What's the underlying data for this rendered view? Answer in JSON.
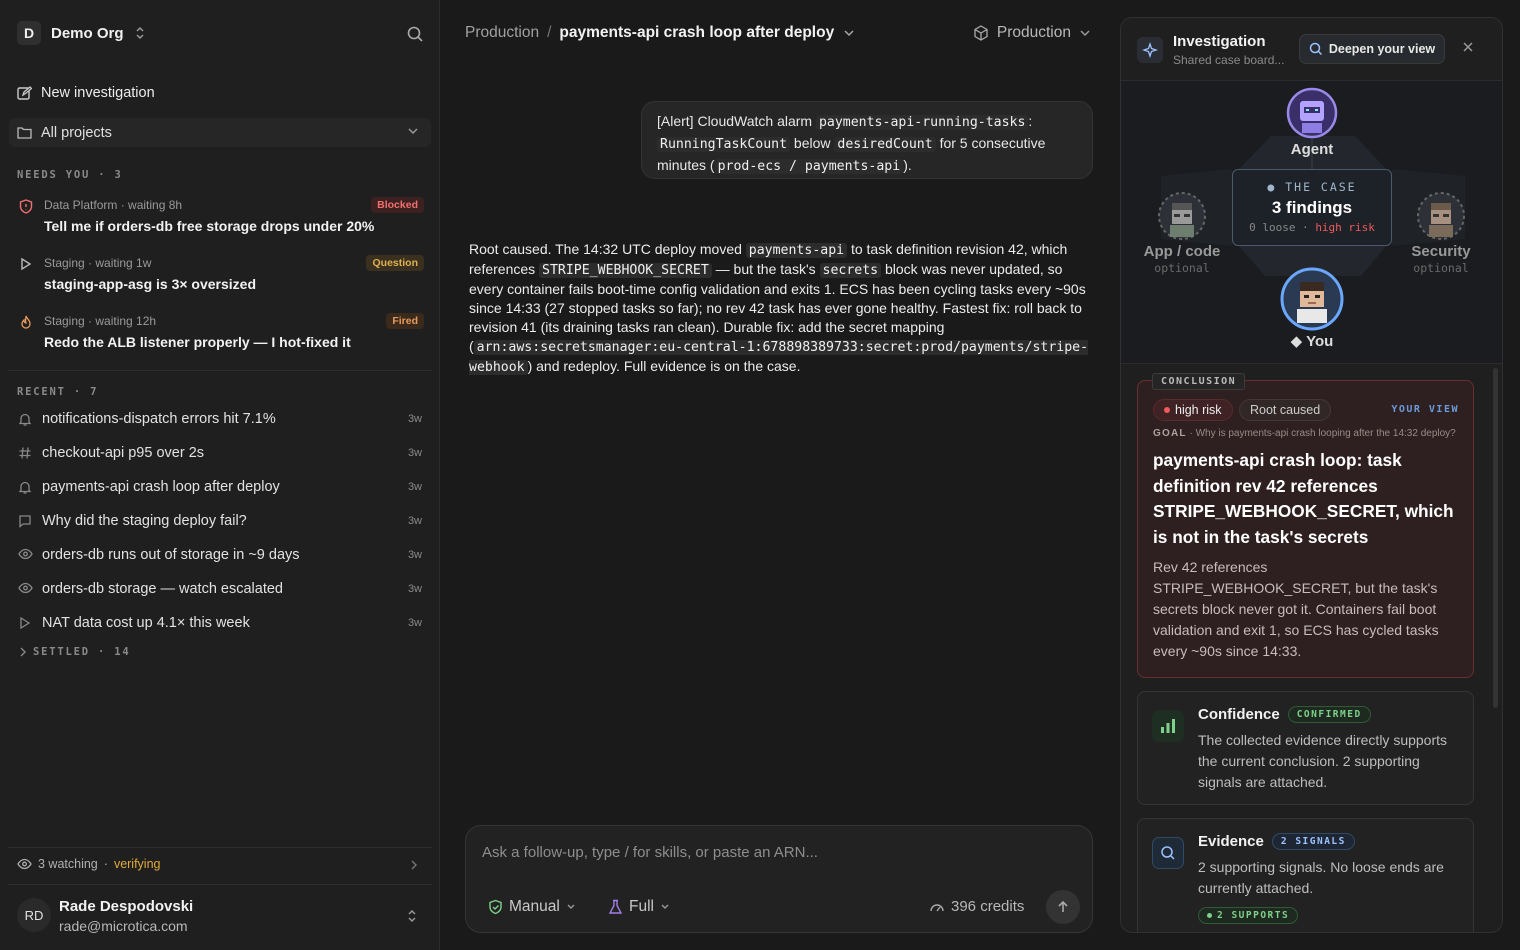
{
  "org": {
    "initial": "D",
    "name": "Demo Org"
  },
  "nav": {
    "new_investigation": "New investigation",
    "all_projects": "All projects"
  },
  "needs_you": {
    "label": "NEEDS YOU · 3",
    "items": [
      {
        "meta": "Data Platform · waiting 8h",
        "title": "Tell me if orders-db free storage drops under 20%",
        "badge": "Blocked",
        "icon": "shield-alert-icon"
      },
      {
        "meta": "Staging · waiting 1w",
        "title": "staging-app-asg is 3× oversized",
        "badge": "Question",
        "icon": "play-icon"
      },
      {
        "meta": "Staging · waiting 12h",
        "title": "Redo the ALB listener properly — I hot-fixed it",
        "badge": "Fired",
        "icon": "flame-icon"
      }
    ]
  },
  "recent": {
    "label": "RECENT · 7",
    "items": [
      {
        "title": "notifications-dispatch errors hit 7.1%",
        "ago": "3w",
        "icon": "bell-icon"
      },
      {
        "title": "checkout-api p95 over 2s",
        "ago": "3w",
        "icon": "hash-icon"
      },
      {
        "title": "payments-api crash loop after deploy",
        "ago": "3w",
        "icon": "bell-icon"
      },
      {
        "title": "Why did the staging deploy fail?",
        "ago": "3w",
        "icon": "chat-icon"
      },
      {
        "title": "orders-db runs out of storage in ~9 days",
        "ago": "3w",
        "icon": "eye-icon"
      },
      {
        "title": "orders-db storage — watch escalated",
        "ago": "3w",
        "icon": "eye-icon"
      },
      {
        "title": "NAT data cost up 4.1× this week",
        "ago": "3w",
        "icon": "play-icon"
      }
    ]
  },
  "settled": {
    "label": "SETTLED · 14"
  },
  "watching": {
    "count": "3 watching",
    "sep": " · ",
    "status": "verifying"
  },
  "user": {
    "initials": "RD",
    "name": "Rade Despodovski",
    "email": "rade@microtica.com"
  },
  "breadcrumb": {
    "project": "Production",
    "sep": "/",
    "current": "payments-api crash loop after deploy"
  },
  "env_selector": {
    "label": "Production"
  },
  "alert": {
    "t1": "[Alert] CloudWatch alarm ",
    "c1": "payments-api-running-tasks",
    "t2": ":",
    "c2": "RunningTaskCount",
    "t3": " below ",
    "c3": "desiredCount",
    "t4": " for 5 consecutive minutes (",
    "c4": "prod-ecs / payments-api",
    "t5": ")."
  },
  "answer": {
    "t1": "Root caused. The 14:32 UTC deploy moved ",
    "c1": "payments-api",
    "t2": " to task definition revision 42, which references ",
    "c2": "STRIPE_WEBHOOK_SECRET",
    "t3": " — but the task's ",
    "c3": "secrets",
    "t4": " block was never updated, so every container fails boot-time config validation and exits 1. ECS has been cycling tasks every ~90s since 14:33 (27 stopped tasks so far); no rev 42 task has ever gone healthy. Fastest fix: roll back to revision 41 (its draining tasks ran clean). Durable fix: add the secret mapping (",
    "c4": "arn:aws:secretsmanager:eu-central-1:678898389733:secret:prod/payments/stripe-webhook",
    "t5": ") and redeploy. Full evidence is on the case."
  },
  "composer": {
    "placeholder": "Ask a follow-up, type / for skills, or paste an ARN...",
    "mode": "Manual",
    "depth": "Full",
    "credits": "396 credits"
  },
  "panel": {
    "title": "Investigation",
    "subtitle": "Shared case board...",
    "deepen": "Deepen your view",
    "board": {
      "agent": "Agent",
      "app": "App / code",
      "app_sub": "optional",
      "security": "Security",
      "security_sub": "optional",
      "you": "◆ You",
      "case_label": "● THE CASE",
      "findings": "3 findings",
      "loose": "0 loose",
      "dot": " · ",
      "risk": "high risk"
    },
    "conclusion": {
      "tag": "CONCLUSION",
      "risk": "high risk",
      "status": "Root caused",
      "view": "YOUR VIEW",
      "goal_label": "GOAL",
      "goal": " · Why is payments-api crash looping after the 14:32 deploy?",
      "title": "payments-api crash loop: task definition rev 42 references STRIPE_WEBHOOK_SECRET, which is not in the task's secrets",
      "body": "Rev 42 references STRIPE_WEBHOOK_SECRET, but the task's secrets block never got it. Containers fail boot validation and exit 1, so ECS has cycled tasks every ~90s since 14:33."
    },
    "confidence": {
      "title": "Confidence",
      "tag": "CONFIRMED",
      "body": "The collected evidence directly supports the current conclusion. 2 supporting signals are attached."
    },
    "evidence": {
      "title": "Evidence",
      "tag": "2 SIGNALS",
      "body": "2 supporting signals. No loose ends are currently attached.",
      "supports": "2 SUPPORTS"
    }
  },
  "colors": {
    "accent_red": "#f05a5a",
    "accent_blue": "#6a9ad8",
    "accent_green": "#7ed08a",
    "warning": "#e0a93a"
  }
}
